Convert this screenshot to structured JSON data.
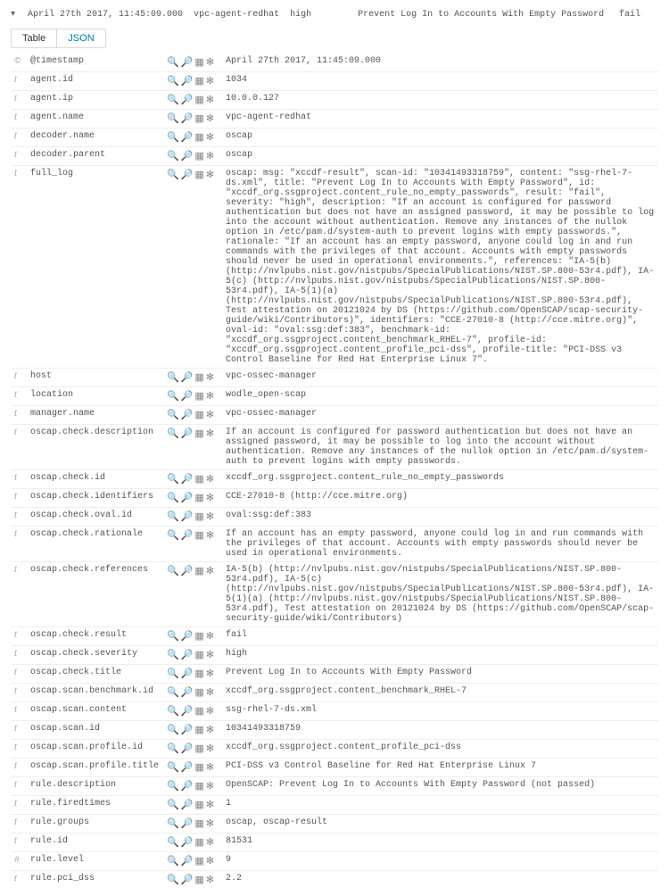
{
  "header": {
    "timestamp": "April 27th 2017, 11:45:09.000",
    "source": "vpc-agent-redhat",
    "severity": "high",
    "title": "Prevent Log In to Accounts With Empty Password",
    "result": "fail"
  },
  "tabs": {
    "table": "Table",
    "json": "JSON"
  },
  "type_glyph": {
    "t": "t",
    "clock": "©",
    "hash": "#"
  },
  "actions": {
    "zoomin": "🔍",
    "zoomout": "🔍",
    "cols": "▥",
    "star": "✱"
  },
  "rows": [
    {
      "type": "clock",
      "field": "@timestamp",
      "value": "April 27th 2017, 11:45:09.000"
    },
    {
      "type": "t",
      "field": "agent.id",
      "value": "1034"
    },
    {
      "type": "t",
      "field": "agent.ip",
      "value": "10.0.0.127"
    },
    {
      "type": "t",
      "field": "agent.name",
      "value": "vpc-agent-redhat"
    },
    {
      "type": "t",
      "field": "decoder.name",
      "value": "oscap"
    },
    {
      "type": "t",
      "field": "decoder.parent",
      "value": "oscap"
    },
    {
      "type": "t",
      "field": "full_log",
      "value": "oscap: msg: \"xccdf-result\", scan-id: \"10341493318759\", content: \"ssg-rhel-7-ds.xml\", title: \"Prevent Log In to Accounts With Empty Password\", id: \"xccdf_org.ssgproject.content_rule_no_empty_passwords\", result: \"fail\", severity: \"high\", description: \"If an account is configured for password authentication but does not have an assigned password, it may be possible to log into the account without authentication. Remove any instances of the nullok option in /etc/pam.d/system-auth to prevent logins with empty passwords.\", rationale: \"If an account has an empty password, anyone could log in and run commands with the privileges of that account. Accounts with empty passwords should never be used in operational environments.\", references: \"IA-5(b) (http://nvlpubs.nist.gov/nistpubs/SpecialPublications/NIST.SP.800-53r4.pdf), IA-5(c) (http://nvlpubs.nist.gov/nistpubs/SpecialPublications/NIST.SP.800-53r4.pdf), IA-5(1)(a) (http://nvlpubs.nist.gov/nistpubs/SpecialPublications/NIST.SP.800-53r4.pdf), Test attestation on 20121024 by DS (https://github.com/OpenSCAP/scap-security-guide/wiki/Contributors)\", identifiers: \"CCE-27010-8 (http://cce.mitre.org)\", oval-id: \"oval:ssg:def:383\", benchmark-id: \"xccdf_org.ssgproject.content_benchmark_RHEL-7\", profile-id: \"xccdf_org.ssgproject.content_profile_pci-dss\", profile-title: \"PCI-DSS v3 Control Baseline for Red Hat Enterprise Linux 7\"."
    },
    {
      "type": "t",
      "field": "host",
      "value": "vpc-ossec-manager"
    },
    {
      "type": "t",
      "field": "location",
      "value": "wodle_open-scap"
    },
    {
      "type": "t",
      "field": "manager.name",
      "value": "vpc-ossec-manager"
    },
    {
      "type": "t",
      "field": "oscap.check.description",
      "value": "If an account is configured for password authentication but does not have an assigned password, it may be possible to log into the account without authentication. Remove any instances of the nullok option in /etc/pam.d/system-auth to prevent logins with empty passwords."
    },
    {
      "type": "t",
      "field": "oscap.check.id",
      "value": "xccdf_org.ssgproject.content_rule_no_empty_passwords"
    },
    {
      "type": "t",
      "field": "oscap.check.identifiers",
      "value": "CCE-27010-8 (http://cce.mitre.org)"
    },
    {
      "type": "t",
      "field": "oscap.check.oval.id",
      "value": "oval:ssg:def:383"
    },
    {
      "type": "t",
      "field": "oscap.check.rationale",
      "value": "If an account has an empty password, anyone could log in and run commands with the privileges of that account. Accounts with empty passwords should never be used in operational environments."
    },
    {
      "type": "t",
      "field": "oscap.check.references",
      "value": "IA-5(b) (http://nvlpubs.nist.gov/nistpubs/SpecialPublications/NIST.SP.800-53r4.pdf), IA-5(c) (http://nvlpubs.nist.gov/nistpubs/SpecialPublications/NIST.SP.800-53r4.pdf), IA-5(1)(a) (http://nvlpubs.nist.gov/nistpubs/SpecialPublications/NIST.SP.800-53r4.pdf), Test attestation on 20121024 by DS (https://github.com/OpenSCAP/scap-security-guide/wiki/Contributors)"
    },
    {
      "type": "t",
      "field": "oscap.check.result",
      "value": "fail"
    },
    {
      "type": "t",
      "field": "oscap.check.severity",
      "value": "high"
    },
    {
      "type": "t",
      "field": "oscap.check.title",
      "value": "Prevent Log In to Accounts With Empty Password"
    },
    {
      "type": "t",
      "field": "oscap.scan.benchmark.id",
      "value": "xccdf_org.ssgproject.content_benchmark_RHEL-7"
    },
    {
      "type": "t",
      "field": "oscap.scan.content",
      "value": "ssg-rhel-7-ds.xml"
    },
    {
      "type": "t",
      "field": "oscap.scan.id",
      "value": "10341493318759"
    },
    {
      "type": "t",
      "field": "oscap.scan.profile.id",
      "value": "xccdf_org.ssgproject.content_profile_pci-dss"
    },
    {
      "type": "t",
      "field": "oscap.scan.profile.title",
      "value": "PCI-DSS v3 Control Baseline for Red Hat Enterprise Linux 7"
    },
    {
      "type": "t",
      "field": "rule.description",
      "value": "OpenSCAP: Prevent Log In to Accounts With Empty Password (not passed)"
    },
    {
      "type": "t",
      "field": "rule.firedtimes",
      "value": "1"
    },
    {
      "type": "t",
      "field": "rule.groups",
      "value": "oscap, oscap-result"
    },
    {
      "type": "t",
      "field": "rule.id",
      "value": "81531"
    },
    {
      "type": "hash",
      "field": "rule.level",
      "value": "9"
    },
    {
      "type": "t",
      "field": "rule.pci_dss",
      "value": "2.2"
    }
  ]
}
